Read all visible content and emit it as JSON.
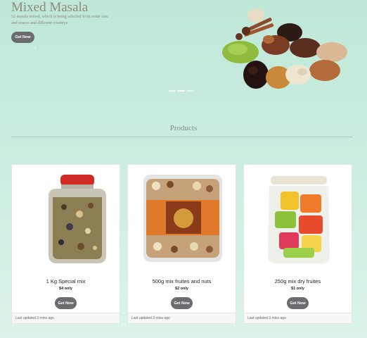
{
  "hero": {
    "title": "Mixed Masala",
    "description": "52 masala mixed, which is being selected from some rare and source and different countrys",
    "button_label": "Get Now"
  },
  "products_heading": "Products",
  "products": [
    {
      "title": "1 Kg Special mix",
      "price": "$4 only",
      "button_label": "Get Now",
      "updated": "Last updated 3 mins ago"
    },
    {
      "title": "500g mix fruites and nuts",
      "price": "$2 only",
      "button_label": "Get Now",
      "updated": "Last updated 3 mins ago"
    },
    {
      "title": "250g mix dry fruites",
      "price": "$1 only",
      "button_label": "Get Now",
      "updated": "Last updated 3 mins ago"
    }
  ],
  "colors": {
    "background_top": "#bfe8d8",
    "background_bottom": "#dcf4e9",
    "button": "#6c6c70",
    "title_text": "#8e8a7a"
  },
  "icons": [
    "chevron-left-icon"
  ]
}
